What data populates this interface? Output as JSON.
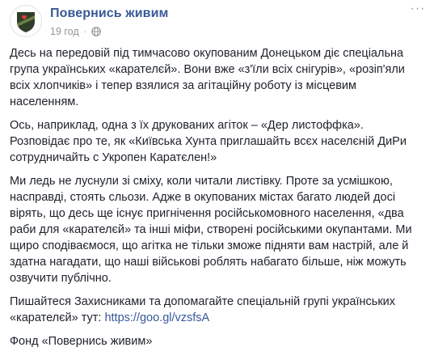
{
  "post": {
    "page_name": "Повернись живим",
    "timestamp": "19 год",
    "separator": "·",
    "privacy_icon": "globe-icon",
    "avatar_icon": "shield-with-heart-icon",
    "menu_icon": "more-options-icon",
    "menu_label": "···",
    "colors": {
      "name": "#385898",
      "meta": "#90949c",
      "text": "#1d2129",
      "link": "#365899",
      "shield_dark": "#2f3d2a",
      "shield_light": "#6a7d46",
      "heart": "#e0403a"
    },
    "paragraphs": {
      "p1": "Десь на передовій під тимчасово окупованим Донецьком діє спеціальна група українських «карателєй». Вони вже «з'їли всіх снігурів», «розіп'яли всіх хлопчиків» і тепер взялися за агітаційну роботу із місцевим населенням.",
      "p2": "Ось, наприклад, одна з їх друкованих агіток – «Дер листоффка». Розповідає про те, як «Київська Хунта приглашайть всєх населєній ДиРи сотрудничайть с Укропен Каратєлен!»",
      "p3": "Ми ледь не луснули зі сміху, коли читали листівку. Проте за усмішкою, насправді, стоять сльози. Адже в окупованих містах багато людей досі вірять, що десь ще існує пригнічення російськомовного населення, «два раби для «карателєй» та інші міфи, створені російськими окупантами. Ми щиро сподіваємося, що агітка не тільки зможе підняти вам настрій, але й здатна нагадати, що наші військові роблять набагато більше, ніж можуть озвучити публічно.",
      "p4_text": "Пишайтеся Захисниками та допомагайте спеціальній групі українських «карателєй» тут: ",
      "p4_link": "https://goo.gl/vzsfsA",
      "p5": "Фонд «Повернись живим»"
    }
  }
}
